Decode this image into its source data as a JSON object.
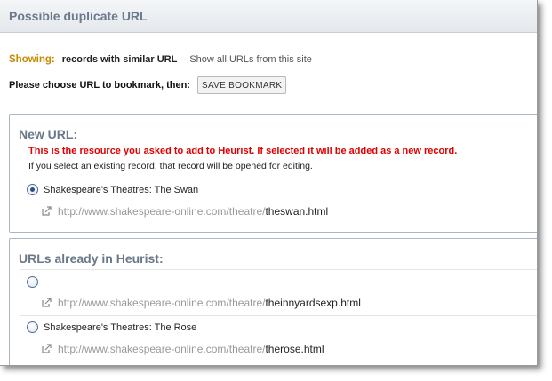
{
  "dialog": {
    "title": "Possible duplicate URL"
  },
  "filter": {
    "showing_label": "Showing:",
    "showing_text": "records with similar URL",
    "show_all_link": "Show all URLs from this site"
  },
  "choose": {
    "text": "Please choose URL to bookmark, then:",
    "save_button": "SAVE BOOKMARK"
  },
  "new_url": {
    "heading": "New URL:",
    "warning": "This is the resource you asked to add to Heurist. If selected it will be added as a new record.",
    "info": "If you select an existing record, that record will be opened for editing.",
    "option_title": "Shakespeare's Theatres: The Swan",
    "option_checked": true,
    "url_prefix": "http://www.shakespeare-online.com/theatre/",
    "url_file": "theswan.html"
  },
  "existing": {
    "heading": "URLs already in Heurist:",
    "items": [
      {
        "title": "",
        "url_prefix": "http://www.shakespeare-online.com/theatre/",
        "url_file": "theinnyardsexp.html"
      },
      {
        "title": "Shakespeare's Theatres: The Rose",
        "url_prefix": "http://www.shakespeare-online.com/theatre/",
        "url_file": "therose.html"
      }
    ]
  }
}
